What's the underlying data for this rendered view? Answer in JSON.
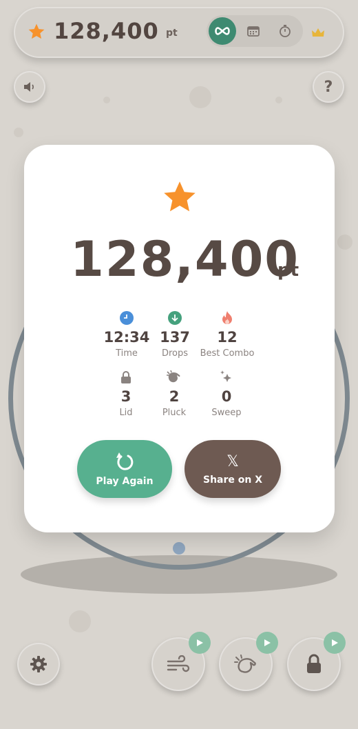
{
  "top_bar": {
    "score": "128,400",
    "unit": "pt"
  },
  "icons": {
    "star": "star-icon",
    "infinity": "infinity-icon",
    "calendar": "calendar-icon",
    "timer": "stopwatch-icon",
    "crown": "crown-icon",
    "sound": "speaker-icon",
    "help": "?",
    "settings": "gear-icon",
    "wind": "wind-icon",
    "pluck": "hand-icon",
    "lock": "lock-icon"
  },
  "help_label": "?",
  "result": {
    "score": "128,400",
    "unit": "pt",
    "stats": [
      {
        "value": "12:34",
        "label": "Time",
        "icon": "clock-icon",
        "color": "#4a8fd9"
      },
      {
        "value": "137",
        "label": "Drops",
        "icon": "arrow-down-icon",
        "color": "#45a17d"
      },
      {
        "value": "12",
        "label": "Best Combo",
        "icon": "flame-icon",
        "color": "#ef7f6f"
      },
      {
        "value": "3",
        "label": "Lid",
        "icon": "lock-icon",
        "color": "#8a8380"
      },
      {
        "value": "2",
        "label": "Pluck",
        "icon": "hand-icon",
        "color": "#8a8380"
      },
      {
        "value": "0",
        "label": "Sweep",
        "icon": "sparkle-icon",
        "color": "#8a8380"
      }
    ],
    "play_again": "Play Again",
    "share": "Share on X",
    "x_logo": "𝕏"
  },
  "colors": {
    "accent_green": "#57b08f",
    "brown": "#6e5a52",
    "star": "#f7922c"
  }
}
